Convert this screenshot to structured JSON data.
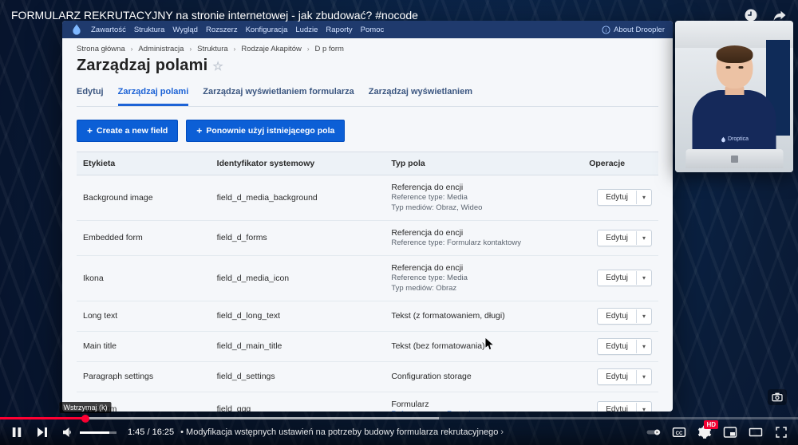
{
  "video": {
    "title": "FORMULARZ REKRUTACYJNY na stronie internetowej - jak zbudować? #nocode",
    "tooltip": "Wstrzymaj (k)",
    "current": "1:45",
    "duration": "16:25",
    "chapter": "Modyfikacja wstępnych ustawień na potrzeby budowy formularza rekrutacyjnego",
    "sep": " / ",
    "bullet": " • ",
    "progress_pct": 0.107,
    "cc_label": "HD"
  },
  "webcam": {
    "shirt_badge": "Droptica"
  },
  "admin": {
    "topmenu": {
      "items": [
        "Zawartość",
        "Struktura",
        "Wygląd",
        "Rozszerz",
        "Konfiguracja",
        "Ludzie",
        "Raporty",
        "Pomoc"
      ],
      "about": "About Droopler"
    },
    "breadcrumb": [
      "Strona główna",
      "Administracja",
      "Struktura",
      "Rodzaje Akapitów",
      "D p form"
    ],
    "title": "Zarządzaj polami",
    "tabs": {
      "edit": "Edytuj",
      "manage_fields": "Zarządzaj polami",
      "manage_form": "Zarządzaj wyświetlaniem formularza",
      "manage_display": "Zarządzaj wyświetlaniem"
    },
    "buttons": {
      "create": "Create a new field",
      "reuse": "Ponownie użyj istniejącego pola"
    },
    "table": {
      "headers": {
        "label": "Etykieta",
        "machine": "Identyfikator systemowy",
        "type": "Typ pola",
        "ops": "Operacje"
      },
      "op_label": "Edytuj",
      "rows": [
        {
          "label": "Background image",
          "machine": "field_d_media_background",
          "type_lines": [
            "Referencja do encji",
            "Reference type: Media",
            "Typ mediów: Obraz, Wideo"
          ]
        },
        {
          "label": "Embedded form",
          "machine": "field_d_forms",
          "type_lines": [
            "Referencja do encji",
            "Reference type: Formularz kontaktowy"
          ]
        },
        {
          "label": "Ikona",
          "machine": "field_d_media_icon",
          "type_lines": [
            "Referencja do encji",
            "Reference type: Media",
            "Typ mediów: Obraz"
          ]
        },
        {
          "label": "Long text",
          "machine": "field_d_long_text",
          "type_lines": [
            "Tekst (z formatowaniem, długi)"
          ]
        },
        {
          "label": "Main title",
          "machine": "field_d_main_title",
          "type_lines": [
            "Tekst (bez formatowania)"
          ]
        },
        {
          "label": "Paragraph settings",
          "machine": "field_d_settings",
          "type_lines": [
            "Configuration storage"
          ]
        },
        {
          "label": "Webform",
          "machine": "field_ggg",
          "type_lines": [
            "Formularz"
          ],
          "type_highlight": "Reference type: Formularz"
        }
      ]
    }
  }
}
